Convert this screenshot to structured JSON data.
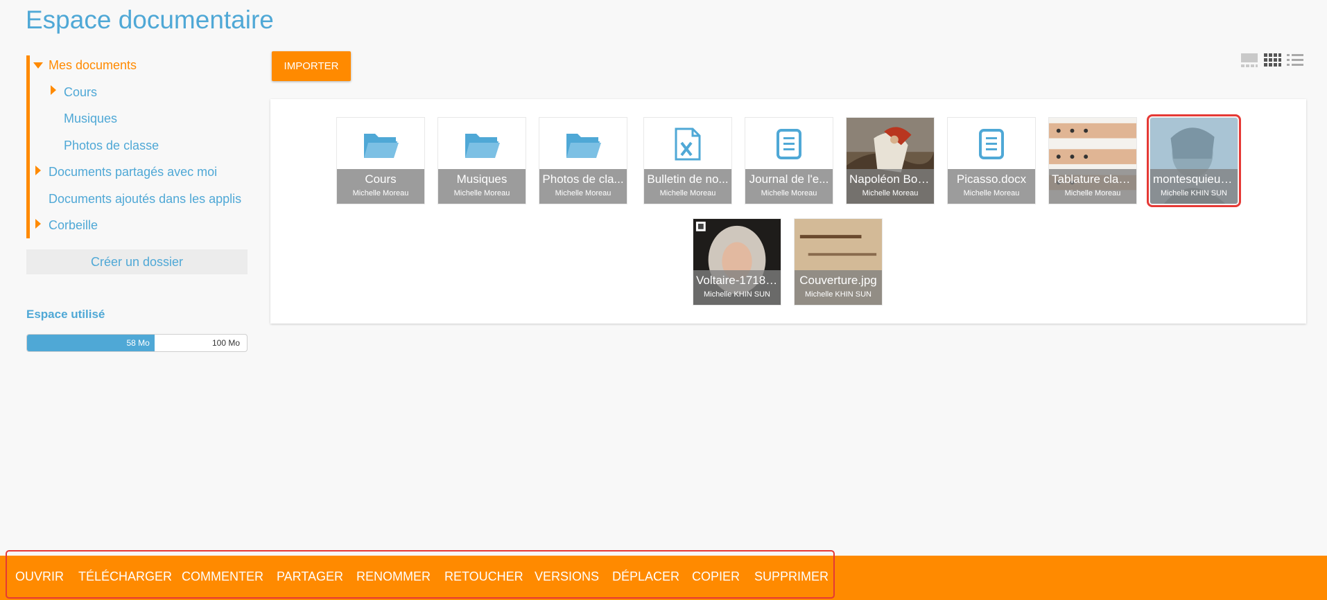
{
  "page": {
    "title": "Espace documentaire"
  },
  "sidebar": {
    "tree": {
      "mes_documents": "Mes documents",
      "cours": "Cours",
      "musiques": "Musiques",
      "photos": "Photos de classe",
      "partages": "Documents partagés avec moi",
      "applis": "Documents ajoutés dans les applis",
      "corbeille": "Corbeille"
    },
    "create_folder": "Créer un dossier",
    "space": {
      "title": "Espace utilisé",
      "used": "58 Mo",
      "max": "100 Mo",
      "used_fraction": 0.58
    }
  },
  "toolbar": {
    "import_label": "IMPORTER",
    "view_modes": [
      "thumbnails-large-icon",
      "thumbnails-grid-icon",
      "list-view-icon"
    ]
  },
  "files": [
    {
      "name": "Cours",
      "owner": "Michelle Moreau",
      "kind": "folder"
    },
    {
      "name": "Musiques",
      "owner": "Michelle Moreau",
      "kind": "folder"
    },
    {
      "name": "Photos de cla...",
      "owner": "Michelle Moreau",
      "kind": "folder"
    },
    {
      "name": "Bulletin de no...",
      "owner": "Michelle Moreau",
      "kind": "spreadsheet"
    },
    {
      "name": "Journal de l'e...",
      "owner": "Michelle Moreau",
      "kind": "document"
    },
    {
      "name": "Napoléon Bon...",
      "owner": "Michelle Moreau",
      "kind": "image"
    },
    {
      "name": "Picasso.docx",
      "owner": "Michelle Moreau",
      "kind": "document"
    },
    {
      "name": "Tablature clari...",
      "owner": "Michelle Moreau",
      "kind": "image"
    },
    {
      "name": "montesquieu_...",
      "owner": "Michelle KHIN SUN",
      "kind": "image",
      "selected": true
    },
    {
      "name": "Voltaire-1718....",
      "owner": "Michelle KHIN SUN",
      "kind": "image"
    },
    {
      "name": "Couverture.jpg",
      "owner": "Michelle KHIN SUN",
      "kind": "image"
    }
  ],
  "actions": {
    "open": "OUVRIR",
    "download": "TÉLÉCHARGER",
    "comment": "COMMENTER",
    "share": "PARTAGER",
    "rename": "RENOMMER",
    "retouch": "RETOUCHER",
    "versions": "VERSIONS",
    "move": "DÉPLACER",
    "copy": "COPIER",
    "delete": "SUPPRIMER"
  },
  "colors": {
    "accent": "#ff8a00",
    "brand": "#4fa8d6",
    "highlight": "#e53935"
  }
}
